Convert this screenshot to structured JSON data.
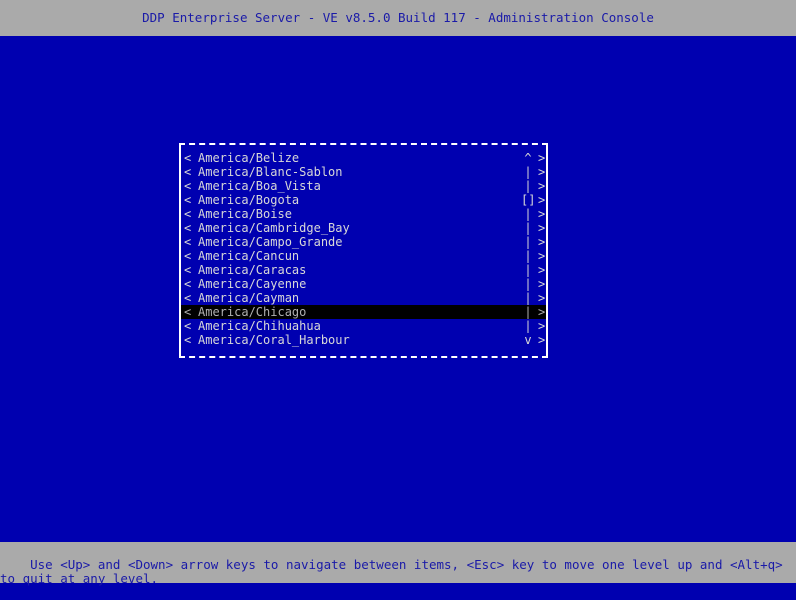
{
  "window": {
    "title": "DDP Enterprise Server - VE v8.5.0 Build 117 - Administration Console"
  },
  "colors": {
    "screen_background": "#0000b0",
    "chrome_background": "#aaaaaa",
    "chrome_text": "#1a1aa8",
    "list_text": "#d8d8d8",
    "selection_background": "#000000",
    "selection_text": "#b0b0b0",
    "border": "#ffffff"
  },
  "list": {
    "left_marker": "<",
    "right_marker": ">",
    "scrollbar": {
      "up_arrow": "^",
      "down_arrow": "v",
      "track": "|",
      "thumb": "[]",
      "thumb_row_index": 3
    },
    "selected_index": 11,
    "items": [
      {
        "label": "America/Belize",
        "scroll": "^"
      },
      {
        "label": "America/Blanc-Sablon",
        "scroll": "|"
      },
      {
        "label": "America/Boa_Vista",
        "scroll": "|"
      },
      {
        "label": "America/Bogota",
        "scroll": "[]"
      },
      {
        "label": "America/Boise",
        "scroll": "|"
      },
      {
        "label": "America/Cambridge_Bay",
        "scroll": "|"
      },
      {
        "label": "America/Campo_Grande",
        "scroll": "|"
      },
      {
        "label": "America/Cancun",
        "scroll": "|"
      },
      {
        "label": "America/Caracas",
        "scroll": "|"
      },
      {
        "label": "America/Cayenne",
        "scroll": "|"
      },
      {
        "label": "America/Cayman",
        "scroll": "|"
      },
      {
        "label": "America/Chicago",
        "scroll": "|"
      },
      {
        "label": "America/Chihuahua",
        "scroll": "|"
      },
      {
        "label": "America/Coral_Harbour",
        "scroll": "v"
      }
    ]
  },
  "status": {
    "text": "Use <Up> and <Down> arrow keys to navigate between items, <Esc> key to move one level up and <Alt+q> to quit at any level."
  }
}
